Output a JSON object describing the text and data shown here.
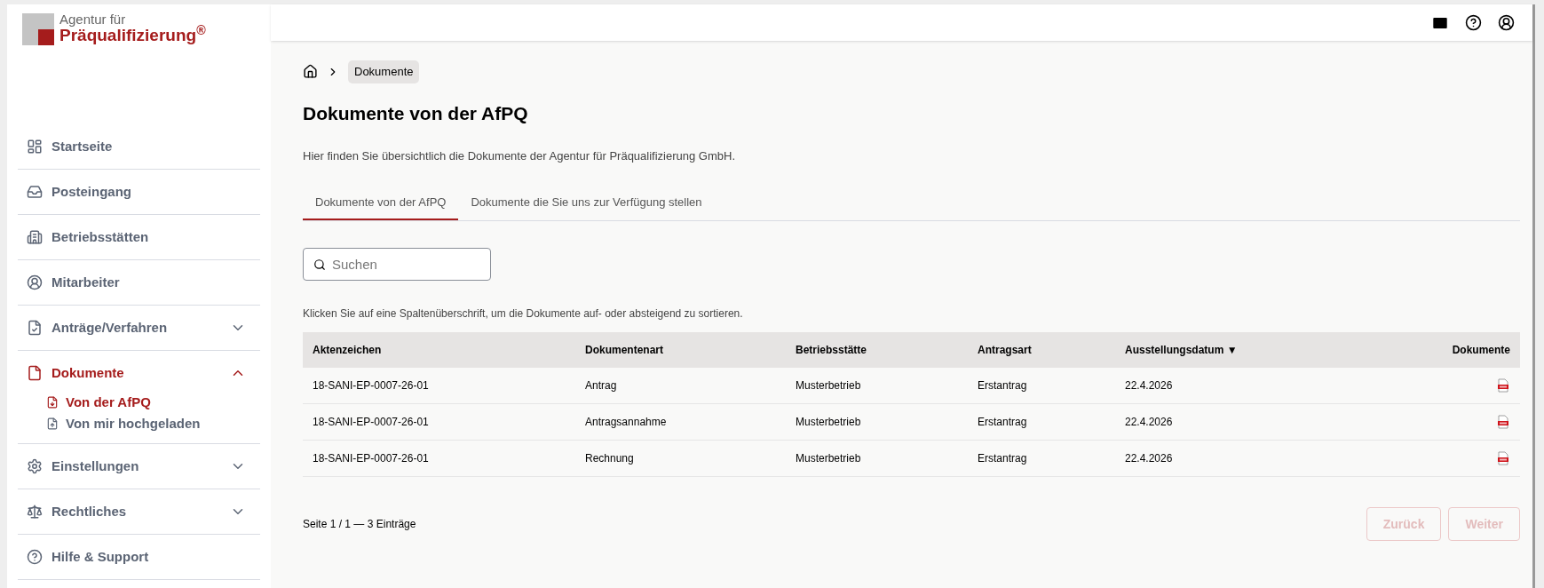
{
  "logo": {
    "line1": "Agentur für",
    "line2": "Präqualifizierung$^{®}$"
  },
  "sidebar": {
    "items": [
      {
        "label": "Startseite",
        "selected": false
      },
      {
        "label": "Posteingang",
        "selected": false
      },
      {
        "label": "Betriebsstätten",
        "selected": false
      },
      {
        "label": "Mitarbeiter",
        "selected": false
      },
      {
        "label": "Anträge/Verfahren",
        "selected": false,
        "expanded": false
      },
      {
        "label": "Dokumente",
        "selected": true,
        "expanded": true,
        "children": [
          {
            "label": "Von der AfPQ",
            "selected": true
          },
          {
            "label": "Von mir hochgeladen",
            "selected": false
          }
        ]
      },
      {
        "label": "Einstellungen",
        "selected": false,
        "expanded": false
      },
      {
        "label": "Rechtliches",
        "selected": false,
        "expanded": false
      },
      {
        "label": "Hilfe & Support",
        "selected": false
      }
    ]
  },
  "breadcrumb": [
    "Dokumente"
  ],
  "title": "Dokumente von der AfPQ",
  "description": "Hier finden Sie übersichtlich die Dokumente der Agentur für Präqualifizierung GmbH.",
  "tabs": [
    {
      "label": "Dokumente von der AfPQ",
      "selected": true
    },
    {
      "label": "Dokumente die Sie uns zur Verfügung stellen",
      "selected": false
    }
  ],
  "search": {
    "placeholder": "Suchen"
  },
  "hint": "Klicken Sie auf eine Spaltenüberschrift, um die Dokumente auf- oder absteigend zu sortieren.",
  "table": {
    "columns": [
      {
        "label": "Aktenzeichen"
      },
      {
        "label": "Dokumentenart"
      },
      {
        "label": "Betriebsstätte"
      },
      {
        "label": "Antragsart"
      },
      {
        "label": "Ausstellungsdatum",
        "sort": "▼"
      },
      {
        "label": "Dokumente"
      }
    ],
    "rows": [
      {
        "cells": [
          "18-SANI-EP-0007-26-01",
          "Antrag",
          "Musterbetrieb",
          "Erstantrag",
          "22.4.2026"
        ]
      },
      {
        "cells": [
          "18-SANI-EP-0007-26-01",
          "Antragsannahme",
          "Musterbetrieb",
          "Erstantrag",
          "22.4.2026"
        ]
      },
      {
        "cells": [
          "18-SANI-EP-0007-26-01",
          "Rechnung",
          "Musterbetrieb",
          "Erstantrag",
          "22.4.2026"
        ]
      }
    ]
  },
  "pagination": {
    "summary": "Seite 1 / 1 — 3 Einträge",
    "buttons": [
      {
        "label": "Zurück",
        "disabled": true
      },
      {
        "label": "Weiter",
        "disabled": true
      }
    ]
  }
}
